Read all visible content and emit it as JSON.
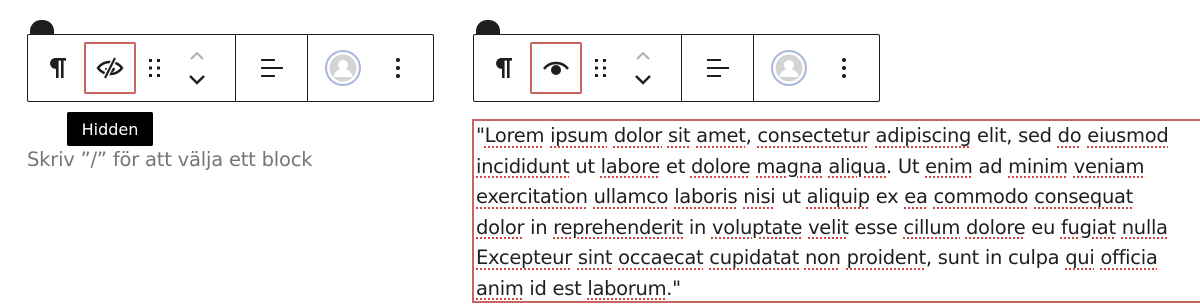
{
  "toolbar_left": {
    "paragraph_icon": "pilcrow-icon",
    "visibility_icon": "eye-hidden-icon",
    "drag_icon": "drag-handle-icon",
    "move_icon": "chevron-up-down-icon",
    "align_icon": "align-left-icon",
    "avatar_icon": "avatar-icon",
    "options_icon": "more-vertical-icon"
  },
  "tooltip": {
    "text": "Hidden"
  },
  "placeholder": {
    "text": "Skriv ”/” för att välja ett block"
  },
  "toolbar_right": {
    "paragraph_icon": "pilcrow-icon",
    "visibility_icon": "eye-icon",
    "drag_icon": "drag-handle-icon",
    "move_icon": "chevron-up-down-icon",
    "align_icon": "align-left-icon",
    "avatar_icon": "avatar-icon",
    "options_icon": "more-vertical-icon"
  },
  "paragraph": {
    "l1": [
      "\"",
      "Lorem",
      " ",
      "ipsum",
      " ",
      "dolor",
      " ",
      "sit",
      " ",
      "amet",
      ", ",
      "consectetur",
      " ",
      "adipiscing",
      " elit, sed ",
      "do",
      " ",
      "eiusmod"
    ],
    "l2": [
      "",
      "incididunt",
      " ut ",
      "labore",
      " et ",
      "dolore",
      " ",
      "magna",
      " ",
      "aliqua",
      ". Ut ",
      "enim",
      " ad ",
      "minim",
      " ",
      "veniam"
    ],
    "l3": [
      "",
      "exercitation",
      " ",
      "ullamco",
      " ",
      "laboris",
      " ",
      "nisi",
      " ut ",
      "aliquip",
      " ex ",
      "ea",
      " ",
      "commodo",
      " ",
      "consequat"
    ],
    "l4": [
      "",
      "dolor",
      " in ",
      "reprehenderit",
      " in ",
      "voluptate",
      " ",
      "velit",
      " esse ",
      "cillum",
      " ",
      "dolore",
      " eu ",
      "fugiat",
      " ",
      "nulla"
    ],
    "l5": [
      "",
      "Excepteur",
      " ",
      "sint",
      " ",
      "occaecat",
      " ",
      "cupidatat",
      " ",
      "non",
      " ",
      "proident",
      ", sunt in culpa ",
      "qui",
      " ",
      "officia"
    ],
    "l6": [
      "",
      "anim",
      " id est ",
      "laborum",
      ".\""
    ]
  },
  "colors": {
    "ink": "#1e1e1e",
    "highlight_border": "#c9645e",
    "spell_underline": "#d0453f",
    "placeholder": "#757575"
  }
}
